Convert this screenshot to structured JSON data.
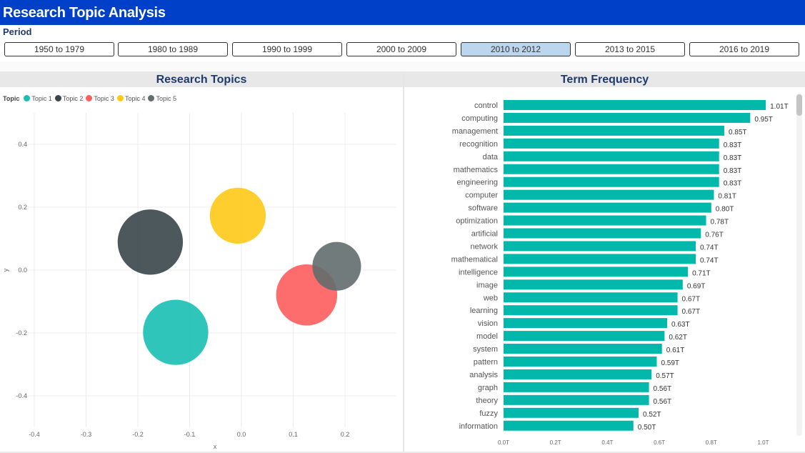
{
  "header": {
    "title": "Research Topic Analysis"
  },
  "period": {
    "label": "Period",
    "options": [
      "1950 to 1979",
      "1980 to 1989",
      "1990 to 1999",
      "2000 to 2009",
      "2010 to 2012",
      "2013 to 2015",
      "2016 to 2019"
    ],
    "selected": "2010 to 2012",
    "selected_color": "#bcd6ee"
  },
  "chart_data": [
    {
      "type": "scatter",
      "title": "Research Topics",
      "legend_title": "Topic",
      "legend_position": "top-left",
      "xlabel": "x",
      "ylabel": "y",
      "xlim": [
        -0.45,
        0.29
      ],
      "ylim": [
        -0.5,
        0.5
      ],
      "x_ticks": [
        -0.4,
        -0.3,
        -0.2,
        -0.1,
        0.0,
        0.1,
        0.2
      ],
      "y_ticks": [
        0.4,
        0.2,
        0.0,
        -0.2,
        -0.4
      ],
      "x_tick_labels": [
        "-0.4",
        "-0.3",
        "-0.2",
        "-0.1",
        "0.0",
        "0.1",
        "0.2"
      ],
      "y_tick_labels": [
        "0.4",
        "0.2",
        "0.0",
        "-0.2",
        "-0.4"
      ],
      "grid": true,
      "series": [
        {
          "name": "Topic 1",
          "x": -0.127,
          "y": -0.198,
          "size": 0.063,
          "color": "#1abfb2"
        },
        {
          "name": "Topic 2",
          "x": -0.176,
          "y": 0.089,
          "size": 0.063,
          "color": "#39464a"
        },
        {
          "name": "Topic 3",
          "x": 0.126,
          "y": -0.079,
          "size": 0.059,
          "color": "#fd5d5d"
        },
        {
          "name": "Topic 4",
          "x": -0.007,
          "y": 0.173,
          "size": 0.054,
          "color": "#fdc917"
        },
        {
          "name": "Topic 5",
          "x": 0.184,
          "y": 0.012,
          "size": 0.047,
          "color": "#636d6d"
        }
      ]
    },
    {
      "type": "bar",
      "orientation": "horizontal",
      "title": "Term Frequency",
      "bar_color": "#01b8aa",
      "xlim": [
        0,
        1.05
      ],
      "x_ticks": [
        0,
        0.2,
        0.4,
        0.6,
        0.8,
        1.0
      ],
      "x_tick_labels": [
        "0.0T",
        "0.2T",
        "0.4T",
        "0.6T",
        "0.8T",
        "1.0T"
      ],
      "categories": [
        "control",
        "computing",
        "management",
        "recognition",
        "data",
        "mathematics",
        "engineering",
        "computer",
        "software",
        "optimization",
        "artificial",
        "network",
        "mathematical",
        "intelligence",
        "image",
        "web",
        "learning",
        "vision",
        "model",
        "system",
        "pattern",
        "analysis",
        "graph",
        "theory",
        "fuzzy",
        "information"
      ],
      "values": [
        1.01,
        0.95,
        0.85,
        0.83,
        0.83,
        0.83,
        0.83,
        0.81,
        0.8,
        0.78,
        0.76,
        0.74,
        0.74,
        0.71,
        0.69,
        0.67,
        0.67,
        0.63,
        0.62,
        0.61,
        0.59,
        0.57,
        0.56,
        0.56,
        0.52,
        0.5
      ],
      "value_labels": [
        "1.01T",
        "0.95T",
        "0.85T",
        "0.83T",
        "0.83T",
        "0.83T",
        "0.83T",
        "0.81T",
        "0.80T",
        "0.78T",
        "0.76T",
        "0.74T",
        "0.74T",
        "0.71T",
        "0.69T",
        "0.67T",
        "0.67T",
        "0.63T",
        "0.62T",
        "0.61T",
        "0.59T",
        "0.57T",
        "0.56T",
        "0.56T",
        "0.52T",
        "0.50T"
      ]
    }
  ]
}
